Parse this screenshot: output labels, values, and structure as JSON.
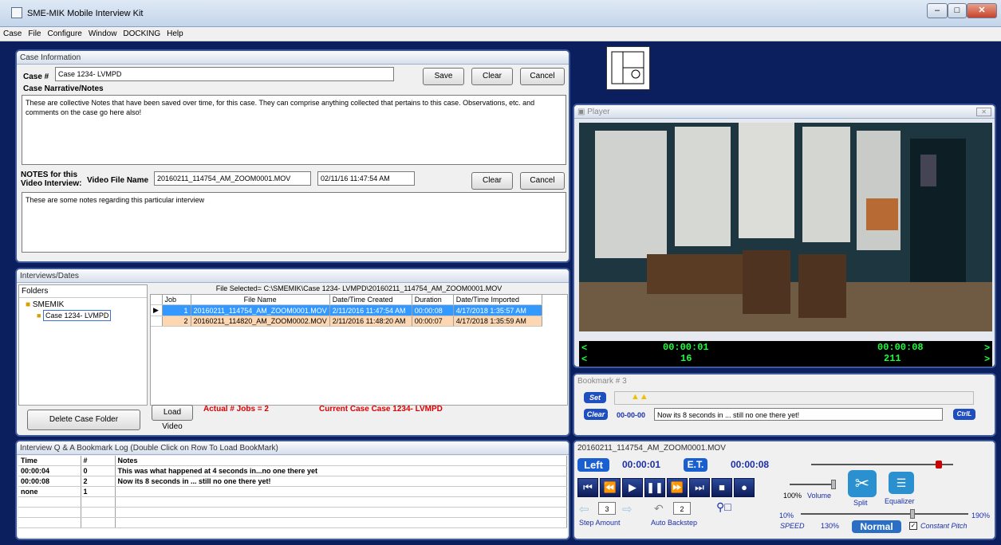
{
  "window": {
    "title": "SME-MIK Mobile Interview Kit"
  },
  "menu": [
    "Case",
    "File",
    "Configure",
    "Window",
    "DOCKING",
    "Help"
  ],
  "case_info": {
    "header": "Case Information",
    "case_label": "Case #",
    "case_value": "Case 1234- LVMPD",
    "narrative_label": "Case Narrative/Notes",
    "narrative_text": "These are collective Notes that have been saved over time, for this case.  They can comprise anything collected that pertains to this case. Observations, etc. and comments on the case go here also!",
    "save": "Save",
    "clear": "Clear",
    "cancel": "Cancel",
    "notes_label_line1": "NOTES for this",
    "notes_label_line2": "Video Interview:",
    "video_file_label": "Video File Name",
    "video_file_value": "20160211_114754_AM_ZOOM0001.MOV",
    "video_datetime": "02/11/16 11:47:54 AM",
    "clear2": "Clear",
    "cancel2": "Cancel",
    "interview_notes": "These are some notes regarding this particular interview"
  },
  "interviews": {
    "header": "Interviews/Dates",
    "folders_label": "Folders",
    "root": "SMEMIK",
    "child": "Case 1234- LVMPD",
    "file_selected": "File Selected= C:\\SMEMIK\\Case 1234- LVMPD\\20160211_114754_AM_ZOOM0001.MOV",
    "columns": [
      "Job",
      "File Name",
      "Date/Time Created",
      "Duration",
      "Date/Time Imported"
    ],
    "rows": [
      [
        "1",
        "20160211_114754_AM_ZOOM0001.MOV",
        "2/11/2016 11:47:54 AM",
        "00:00:08",
        "4/17/2018 1:35:57 AM"
      ],
      [
        "2",
        "20160211_114820_AM_ZOOM0002.MOV",
        "2/11/2016 11:48:20 AM",
        "00:00:07",
        "4/17/2018 1:35:59 AM"
      ]
    ],
    "delete": "Delete Case Folder",
    "load": "Load Video",
    "jobs": "Actual # Jobs =  2",
    "current": "Current Case Case 1234- LVMPD"
  },
  "log": {
    "header": "Interview Q & A Bookmark Log (Double Click on Row To Load BookMark)",
    "columns": [
      "Time",
      "#",
      "Notes"
    ],
    "rows": [
      [
        "00:00:04",
        "0",
        "This was what happened at 4 seconds in...no one there yet"
      ],
      [
        "00:00:08",
        "2",
        " Now its 8 seconds in ... still no one there yet!"
      ],
      [
        "none",
        "1",
        ""
      ]
    ]
  },
  "player": {
    "header": "Player",
    "tc_cur": "00:00:01",
    "tc_total": "00:00:08",
    "frame_cur": "16",
    "frame_total": "211",
    "lt": "<",
    "gt": ">"
  },
  "bookmark": {
    "header": "Bookmark # 3",
    "set": "Set",
    "clear": "Clear",
    "time": "00-00-00",
    "text": "Now its 8 seconds in ... still no one there yet!",
    "ctrl": "CtrlL"
  },
  "transport": {
    "file": "20160211_114754_AM_ZOOM0001.MOV",
    "left_label": "Left",
    "left_value": "00:00:01",
    "et_label": "E.T.",
    "et_value": "00:00:08",
    "volume_pct": "100%",
    "volume_label": "Volume",
    "split": "Split",
    "equalizer": "Equalizer",
    "step_value": "3",
    "step_label": "Step Amount",
    "backstep_value": "2",
    "backstep_label": "Auto Backstep",
    "speed_min": "10%",
    "speed_max": "190%",
    "speed_label": "SPEED",
    "speed_value": "130%",
    "normal": "Normal",
    "pitch": "Constant Pitch",
    "speed_level": 0.67,
    "volume_level": 1.0,
    "position_level": 0.92
  }
}
